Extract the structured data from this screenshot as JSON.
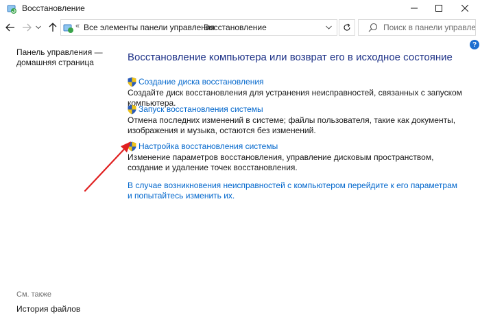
{
  "window": {
    "title": "Восстановление"
  },
  "address": {
    "overflow": "«",
    "crumbs": [
      "Все элементы панели управления",
      "Восстановление"
    ],
    "separator": "›"
  },
  "search": {
    "placeholder": "Поиск в панели управления"
  },
  "help": {
    "label": "?"
  },
  "left_pane": {
    "home_link": "Панель управления — домашняя страница",
    "see_also_heading": "См. также",
    "see_also_items": [
      "История файлов"
    ]
  },
  "main": {
    "title": "Восстановление компьютера или возврат его в исходное состояние",
    "tasks": [
      {
        "link": "Создание диска восстановления",
        "description": "Создайте диск восстановления для устранения неисправностей, связанных с запуском компьютера."
      },
      {
        "link": "Запуск восстановления системы",
        "description": "Отмена последних изменений в системе; файлы пользователя, такие как документы, изображения и музыка, остаются без изменений."
      },
      {
        "link": "Настройка восстановления системы",
        "description": "Изменение параметров восстановления, управление дисковым пространством, создание и удаление точек восстановления."
      }
    ],
    "bottom_link": "В случае возникновения неисправностей с компьютером перейдите к его параметрам и попытайтесь изменить их."
  },
  "colors": {
    "title_blue": "#1e3287",
    "link_blue": "#0066cc",
    "annotation_red": "#e02020"
  }
}
